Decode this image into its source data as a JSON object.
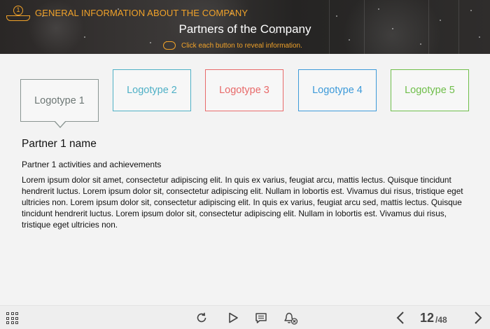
{
  "header": {
    "chapter_number": "1",
    "chapter_title": "GENERAL INFORMATION ABOUT THE COMPANY",
    "page_title": "Partners of the Company",
    "hint": "Click each button to reveal information."
  },
  "logos": [
    {
      "label": "Logotype 1",
      "color": "#6d7775",
      "selected": true
    },
    {
      "label": "Logotype 2",
      "color": "#4fb0c6",
      "selected": false
    },
    {
      "label": "Logotype 3",
      "color": "#e86a6a",
      "selected": false
    },
    {
      "label": "Logotype 4",
      "color": "#3d9ad9",
      "selected": false
    },
    {
      "label": "Logotype 5",
      "color": "#6fbe4a",
      "selected": false
    }
  ],
  "partner": {
    "name": "Partner 1 name",
    "subtitle": "Partner 1 activities and achievements",
    "body": "Lorem ipsum dolor sit amet, consectetur adipiscing elit. In quis ex varius, feugiat arcu, mattis lectus. Quisque tincidunt hendrerit luctus. Lorem ipsum dolor sit, consectetur adipiscing elit. Nullam in lobortis est. Vivamus dui risus, tristique eget ultricies non. Lorem ipsum dolor sit, consectetur adipiscing elit. In quis ex varius, feugiat arcu sed, mattis lectus. Quisque tincidunt hendrerit luctus. Lorem ipsum dolor sit, consectetur adipiscing elit. Nullam in lobortis est. Vivamus dui risus, tristique eget ultricies non."
  },
  "footer": {
    "page_current": "12",
    "page_total": "/48",
    "icons": [
      "menu-icon",
      "replay-icon",
      "play-icon",
      "notes-icon",
      "audio-off-icon",
      "prev-icon",
      "next-icon"
    ]
  },
  "colors": {
    "accent": "#f0a22a"
  }
}
